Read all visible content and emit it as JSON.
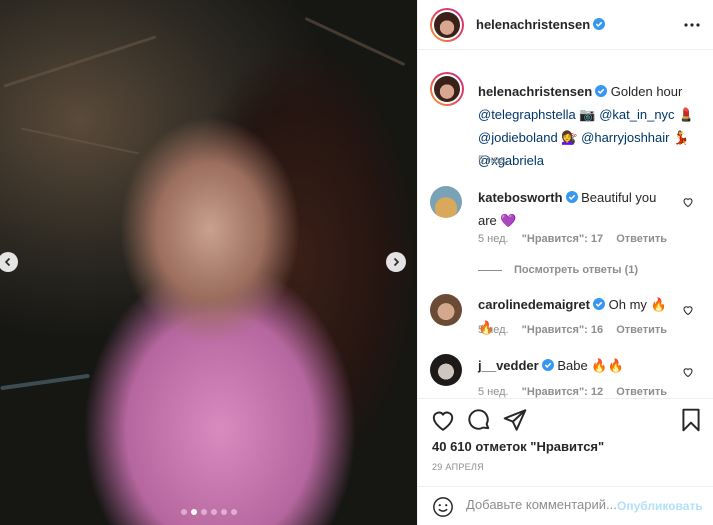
{
  "post": {
    "author": "helenachristensen",
    "photo_count": 6,
    "active_photo": 2
  },
  "caption": {
    "username": "helenachristensen",
    "text": "Golden hour",
    "mention1": "@telegraphstella",
    "emoji1": "📷",
    "mention2": "@kat_in_nyc",
    "emoji2": "💄",
    "mention3": "@jodieboland",
    "emoji3": "💇‍♀️",
    "mention4": "@harryjoshhair",
    "emoji4": "💃",
    "mention5": "@xgabriela",
    "time": "5 нед."
  },
  "comments": [
    {
      "username": "katebosworth",
      "text": "Beautiful you are 💜",
      "time": "5 нед.",
      "likes": "\"Нравится\": 17",
      "reply": "Ответить",
      "view_replies": "Посмотреть ответы (1)"
    },
    {
      "username": "carolinedemaigret",
      "text": "Oh my 🔥🔥",
      "time": "5 нед.",
      "likes": "\"Нравится\": 16",
      "reply": "Ответить"
    },
    {
      "username": "j__vedder",
      "text": "Babe 🔥🔥",
      "time": "5 нед.",
      "likes": "\"Нравится\": 12",
      "reply": "Ответить"
    }
  ],
  "stats": {
    "likes": "40 610 отметок \"Нравится\"",
    "date": "29 АПРЕЛЯ"
  },
  "composer": {
    "placeholder": "Добавьте комментарий...",
    "publish": "Опубликовать"
  },
  "icons": {
    "verified": "verified-badge-icon",
    "more": "more-options-icon",
    "like": "heart-icon",
    "comment": "comment-bubble-icon",
    "share": "paper-plane-icon",
    "save": "bookmark-icon",
    "emoji": "smiley-icon"
  },
  "colors": {
    "verified": "#3897f0",
    "link": "#00376b",
    "muted": "#8e8e8e",
    "publish_disabled": "#b2dffc"
  }
}
